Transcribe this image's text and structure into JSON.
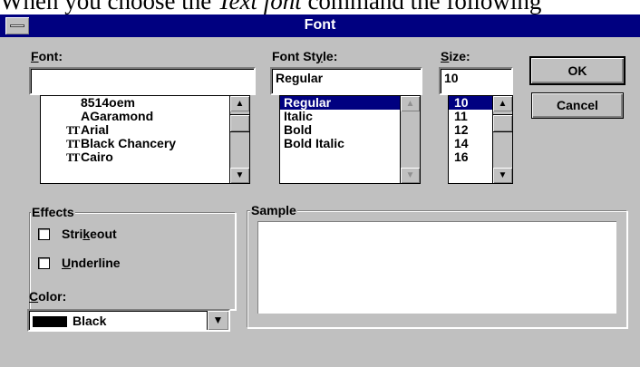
{
  "document": {
    "intro_before": "When you choose the ",
    "intro_emphasis": "Text font",
    "intro_after": " command the following"
  },
  "dialog": {
    "title": "Font",
    "font": {
      "label_pre": "",
      "label_key": "F",
      "label_post": "ont:",
      "value": "",
      "items": [
        {
          "name": "8514oem",
          "icon": ""
        },
        {
          "name": "AGaramond",
          "icon": ""
        },
        {
          "name": "Arial",
          "icon": "TT"
        },
        {
          "name": "Black Chancery",
          "icon": "TT"
        },
        {
          "name": "Cairo",
          "icon": "TT"
        }
      ]
    },
    "style": {
      "label_pre": "Font St",
      "label_key": "y",
      "label_post": "le:",
      "value": "Regular",
      "items": [
        "Regular",
        "Italic",
        "Bold",
        "Bold Italic"
      ]
    },
    "size": {
      "label_pre": "",
      "label_key": "S",
      "label_post": "ize:",
      "value": "10",
      "items": [
        "10",
        "11",
        "12",
        "14",
        "16"
      ]
    },
    "buttons": {
      "ok": "OK",
      "cancel": "Cancel"
    },
    "effects": {
      "title": "Effects",
      "strikeout": {
        "pre": "Stri",
        "key": "k",
        "post": "eout",
        "checked": false
      },
      "underline": {
        "pre": "",
        "key": "U",
        "post": "nderline",
        "checked": false
      }
    },
    "color": {
      "label_pre": "",
      "label_key": "C",
      "label_post": "olor:",
      "value": "Black",
      "swatch": "#000000"
    },
    "sample": {
      "title": "Sample",
      "text": ""
    },
    "colors": {
      "title_bar": "#000080",
      "face": "#c0c0c0",
      "selection": "#000080"
    }
  }
}
